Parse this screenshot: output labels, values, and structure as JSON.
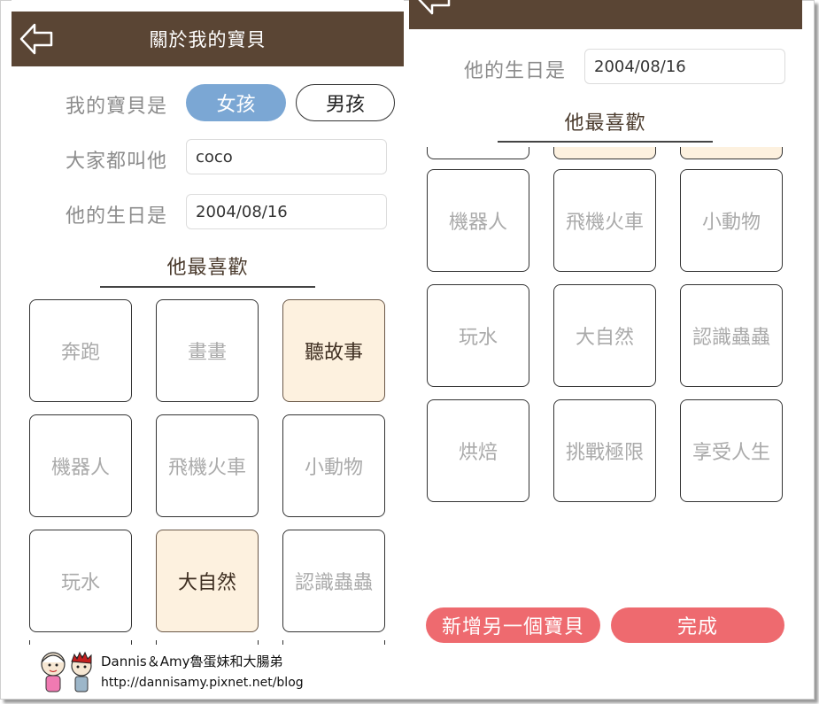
{
  "left": {
    "header": {
      "title": "關於我的寶貝",
      "back_icon": "back-arrow-icon"
    },
    "gender": {
      "label": "我的寶貝是",
      "options": [
        "女孩",
        "男孩"
      ],
      "selected": "女孩"
    },
    "nickname": {
      "label": "大家都叫他",
      "value": "coco"
    },
    "birthday": {
      "label": "他的生日是",
      "value": "2004/08/16"
    },
    "favorites": {
      "heading": "他最喜歡",
      "items": [
        {
          "label": "奔跑",
          "selected": false
        },
        {
          "label": "畫畫",
          "selected": false
        },
        {
          "label": "聽故事",
          "selected": true
        },
        {
          "label": "機器人",
          "selected": false
        },
        {
          "label": "飛機火車",
          "selected": false
        },
        {
          "label": "小動物",
          "selected": false
        },
        {
          "label": "玩水",
          "selected": false
        },
        {
          "label": "大自然",
          "selected": true
        },
        {
          "label": "認識蟲蟲",
          "selected": false
        }
      ]
    }
  },
  "right": {
    "header": {
      "back_icon": "back-arrow-icon"
    },
    "birthday": {
      "label": "他的生日是",
      "value": "2004/08/16"
    },
    "favorites": {
      "heading": "他最喜歡",
      "items": [
        {
          "label": "機器人",
          "selected": false
        },
        {
          "label": "飛機火車",
          "selected": false
        },
        {
          "label": "小動物",
          "selected": false
        },
        {
          "label": "玩水",
          "selected": false
        },
        {
          "label": "大自然",
          "selected": false
        },
        {
          "label": "認識蟲蟲",
          "selected": false
        },
        {
          "label": "烘焙",
          "selected": false
        },
        {
          "label": "挑戰極限",
          "selected": false
        },
        {
          "label": "享受人生",
          "selected": false
        }
      ]
    },
    "add_button": "新增另一個寶貝",
    "done_button": "完成"
  },
  "watermark": {
    "line1": "Dannis＆Amy魯蛋妹和大腸弟",
    "line2": "http://dannisamy.pixnet.net/blog"
  },
  "colors": {
    "header_bg": "#5a4534",
    "selected_pill": "#7ba7d4",
    "selected_tile": "#fdf1df",
    "action_button": "#ee6a6f"
  }
}
